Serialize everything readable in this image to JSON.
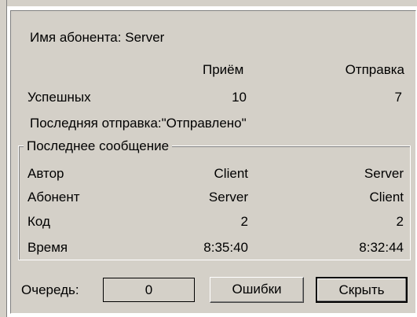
{
  "subscriber": {
    "label": "Имя абонента:",
    "value": "Server"
  },
  "stats": {
    "header_receive": "Приём",
    "header_send": "Отправка",
    "row_label": "Успешных",
    "receive_value": "10",
    "send_value": "7"
  },
  "last_send": {
    "label": "Последняя отправка:",
    "value": "\"Отправлено\""
  },
  "last_message": {
    "title": "Последнее сообщение",
    "rows": [
      {
        "label": "Автор",
        "receive": "Client",
        "send": "Server"
      },
      {
        "label": "Абонент",
        "receive": "Server",
        "send": "Client"
      },
      {
        "label": "Код",
        "receive": "2",
        "send": "2"
      },
      {
        "label": "Время",
        "receive": "8:35:40",
        "send": "8:32:44"
      }
    ]
  },
  "footer": {
    "queue_label": "Очередь:",
    "queue_value": "0",
    "errors_button": "Ошибки",
    "hide_button": "Скрыть"
  }
}
